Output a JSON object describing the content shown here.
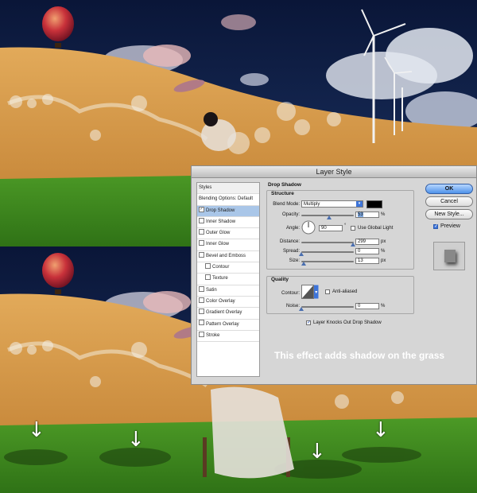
{
  "dialog": {
    "title": "Layer Style",
    "styles_header": "Styles",
    "styles": [
      {
        "label": "Blending Options: Default",
        "checkbox": false,
        "indent": false,
        "selected": false,
        "checked": false
      },
      {
        "label": "Drop Shadow",
        "checkbox": true,
        "indent": false,
        "selected": true,
        "checked": true
      },
      {
        "label": "Inner Shadow",
        "checkbox": true,
        "indent": false,
        "selected": false,
        "checked": false
      },
      {
        "label": "Outer Glow",
        "checkbox": true,
        "indent": false,
        "selected": false,
        "checked": false
      },
      {
        "label": "Inner Glow",
        "checkbox": true,
        "indent": false,
        "selected": false,
        "checked": false
      },
      {
        "label": "Bevel and Emboss",
        "checkbox": true,
        "indent": false,
        "selected": false,
        "checked": false
      },
      {
        "label": "Contour",
        "checkbox": true,
        "indent": true,
        "selected": false,
        "checked": false
      },
      {
        "label": "Texture",
        "checkbox": true,
        "indent": true,
        "selected": false,
        "checked": false
      },
      {
        "label": "Satin",
        "checkbox": true,
        "indent": false,
        "selected": false,
        "checked": false
      },
      {
        "label": "Color Overlay",
        "checkbox": true,
        "indent": false,
        "selected": false,
        "checked": false
      },
      {
        "label": "Gradient Overlay",
        "checkbox": true,
        "indent": false,
        "selected": false,
        "checked": false
      },
      {
        "label": "Pattern Overlay",
        "checkbox": true,
        "indent": false,
        "selected": false,
        "checked": false
      },
      {
        "label": "Stroke",
        "checkbox": true,
        "indent": false,
        "selected": false,
        "checked": false
      }
    ],
    "section_title": "Drop Shadow",
    "structure": {
      "group_label": "Structure",
      "blend_mode_label": "Blend Mode:",
      "blend_mode_value": "Multiply",
      "shadow_color": "#000000",
      "opacity_label": "Opacity:",
      "opacity_value": "53",
      "opacity_unit": "%",
      "opacity_fraction": 0.53,
      "angle_label": "Angle:",
      "angle_value": "90",
      "angle_unit": "°",
      "use_global_light_label": "Use Global Light",
      "distance_label": "Distance:",
      "distance_value": "299",
      "distance_unit": "px",
      "distance_fraction": 0.98,
      "spread_label": "Spread:",
      "spread_value": "0",
      "spread_unit": "%",
      "spread_fraction": 0.0,
      "size_label": "Size:",
      "size_value": "13",
      "size_unit": "px",
      "size_fraction": 0.05
    },
    "quality": {
      "group_label": "Quality",
      "contour_label": "Contour:",
      "anti_aliased_label": "Anti-aliased",
      "noise_label": "Noise:",
      "noise_value": "0",
      "noise_unit": "%",
      "noise_fraction": 0.0
    },
    "knocks_out_label": "Layer Knocks Out Drop Shadow",
    "knocks_out_checked": true,
    "buttons": {
      "ok": "OK",
      "cancel": "Cancel",
      "new_style": "New Style...",
      "preview": "Preview",
      "preview_checked": true
    }
  },
  "caption": "This effect adds shadow on the grass",
  "colors": {
    "sky": "#0d1f4a",
    "sand": "#d9a050",
    "grass": "#3e8a1e",
    "balloon": "#c8313a",
    "dialog_bg": "#d6d6d6",
    "selection": "#a9c6e8"
  },
  "icons": {
    "arrow": "down-arrow-icon"
  }
}
